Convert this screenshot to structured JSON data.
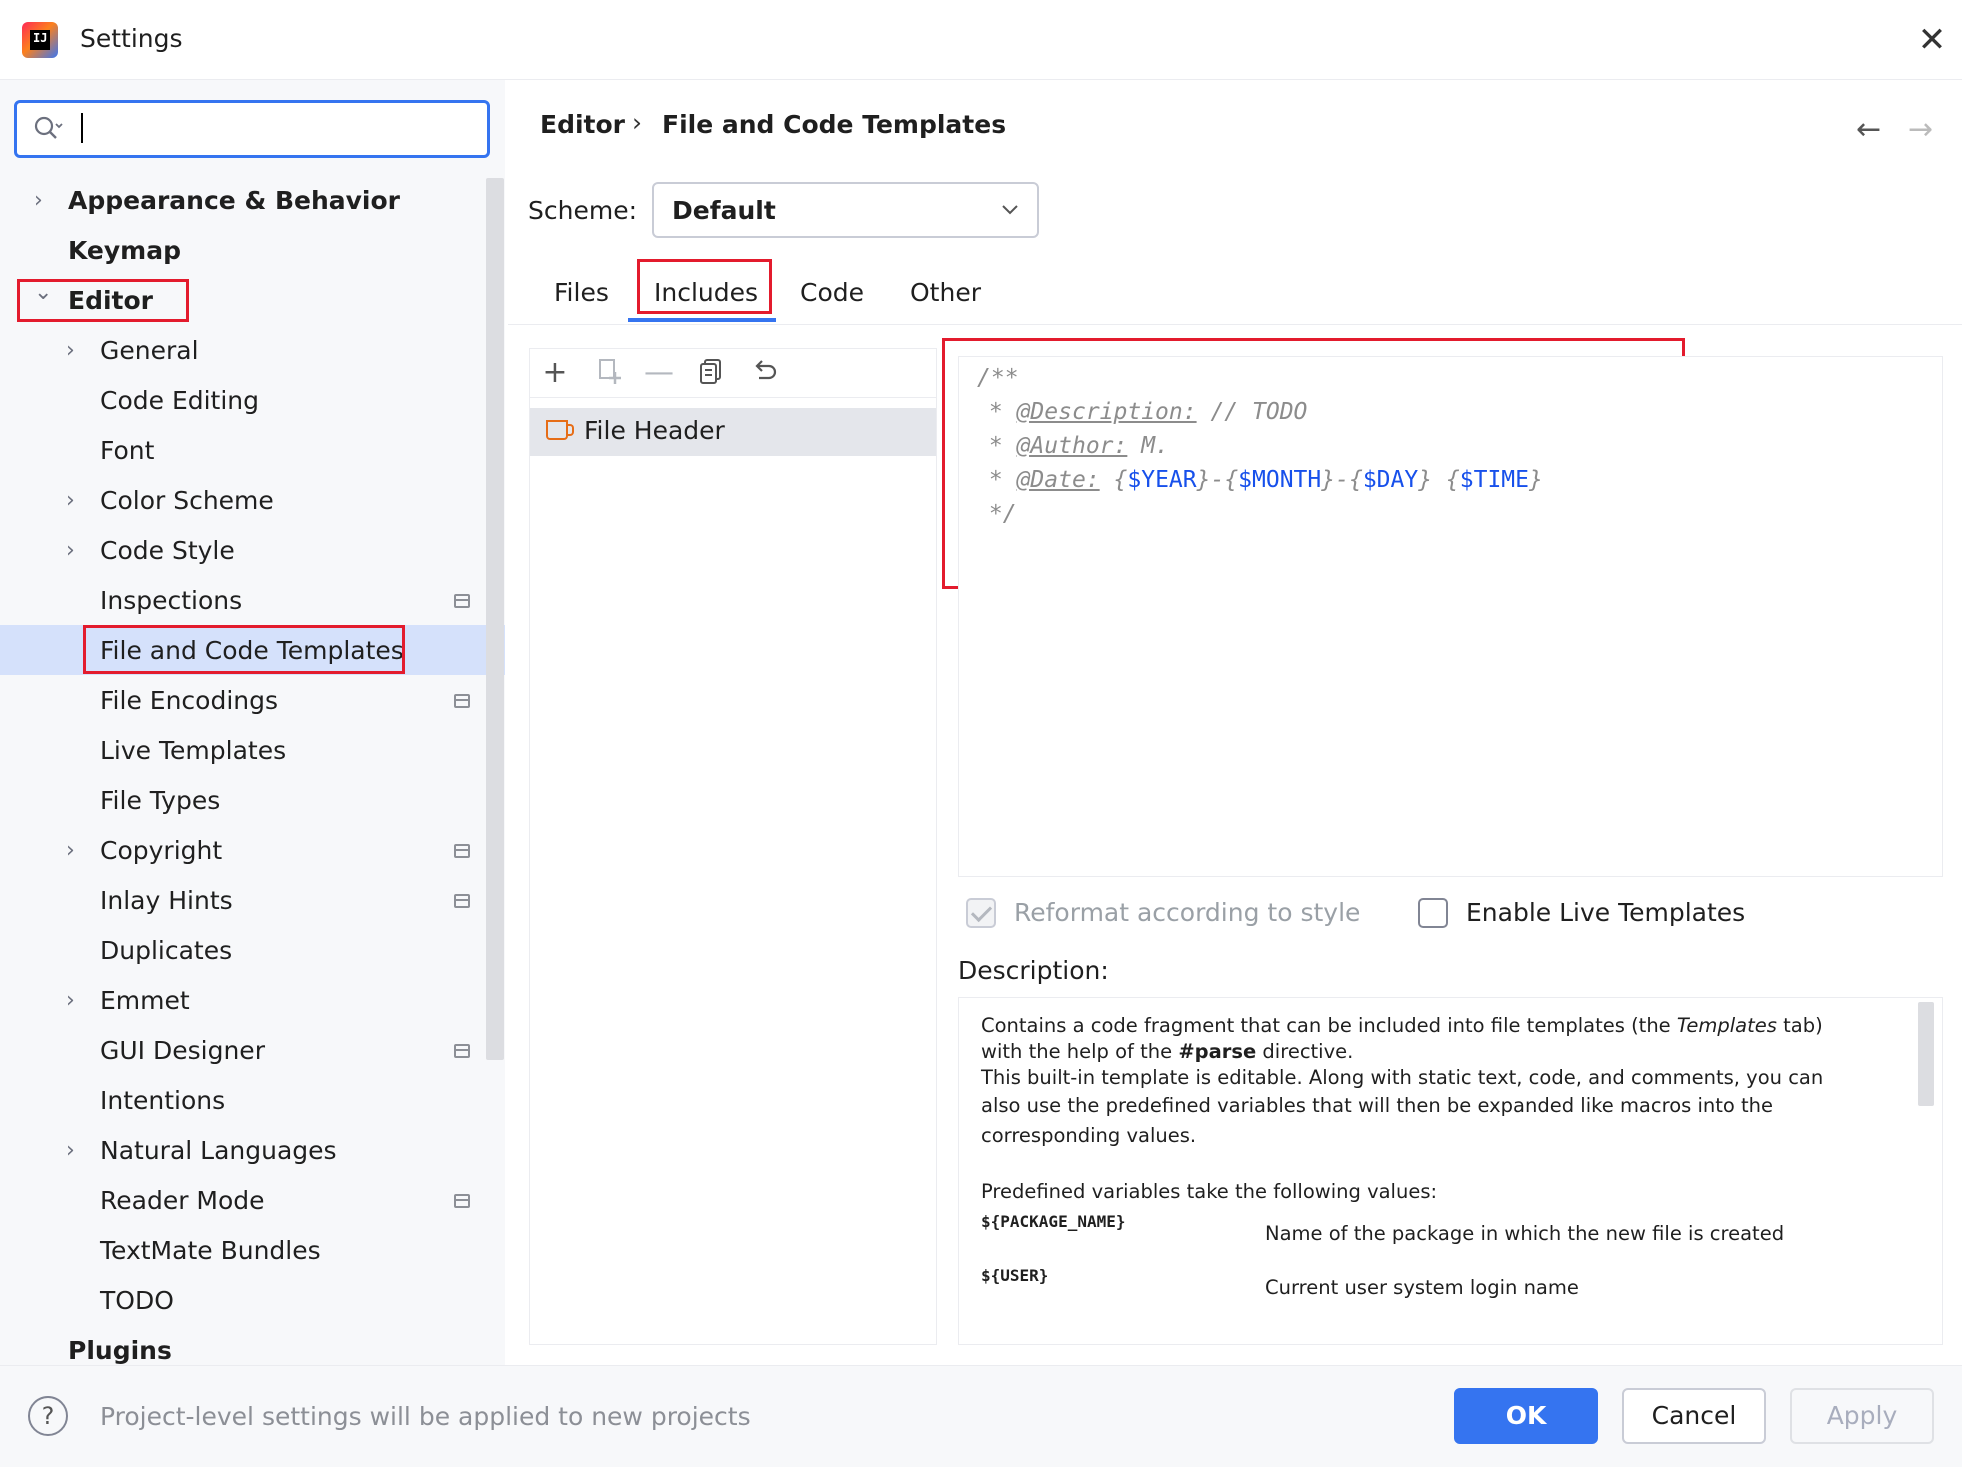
{
  "window": {
    "title": "Settings"
  },
  "sidebar": {
    "items": [
      {
        "label": "Appearance & Behavior",
        "level": 0,
        "bold": true,
        "expander": "collapsed"
      },
      {
        "label": "Keymap",
        "level": 0,
        "bold": true,
        "expander": "none"
      },
      {
        "label": "Editor",
        "level": 0,
        "bold": true,
        "expander": "expanded"
      },
      {
        "label": "General",
        "level": 1,
        "bold": false,
        "expander": "collapsed"
      },
      {
        "label": "Code Editing",
        "level": 1,
        "bold": false,
        "expander": "none"
      },
      {
        "label": "Font",
        "level": 1,
        "bold": false,
        "expander": "none"
      },
      {
        "label": "Color Scheme",
        "level": 1,
        "bold": false,
        "expander": "collapsed"
      },
      {
        "label": "Code Style",
        "level": 1,
        "bold": false,
        "expander": "collapsed"
      },
      {
        "label": "Inspections",
        "level": 1,
        "bold": false,
        "expander": "none",
        "project_icon": true
      },
      {
        "label": "File and Code Templates",
        "level": 1,
        "bold": false,
        "expander": "none",
        "selected": true
      },
      {
        "label": "File Encodings",
        "level": 1,
        "bold": false,
        "expander": "none",
        "project_icon": true
      },
      {
        "label": "Live Templates",
        "level": 1,
        "bold": false,
        "expander": "none"
      },
      {
        "label": "File Types",
        "level": 1,
        "bold": false,
        "expander": "none"
      },
      {
        "label": "Copyright",
        "level": 1,
        "bold": false,
        "expander": "collapsed",
        "project_icon": true
      },
      {
        "label": "Inlay Hints",
        "level": 1,
        "bold": false,
        "expander": "none",
        "project_icon": true
      },
      {
        "label": "Duplicates",
        "level": 1,
        "bold": false,
        "expander": "none"
      },
      {
        "label": "Emmet",
        "level": 1,
        "bold": false,
        "expander": "collapsed"
      },
      {
        "label": "GUI Designer",
        "level": 1,
        "bold": false,
        "expander": "none",
        "project_icon": true
      },
      {
        "label": "Intentions",
        "level": 1,
        "bold": false,
        "expander": "none"
      },
      {
        "label": "Natural Languages",
        "level": 1,
        "bold": false,
        "expander": "collapsed"
      },
      {
        "label": "Reader Mode",
        "level": 1,
        "bold": false,
        "expander": "none",
        "project_icon": true
      },
      {
        "label": "TextMate Bundles",
        "level": 1,
        "bold": false,
        "expander": "none"
      },
      {
        "label": "TODO",
        "level": 1,
        "bold": false,
        "expander": "none"
      },
      {
        "label": "Plugins",
        "level": 0,
        "bold": true,
        "expander": "none"
      }
    ]
  },
  "breadcrumb": {
    "parent": "Editor",
    "separator": "›",
    "current": "File and Code Templates"
  },
  "scheme": {
    "label": "Scheme:",
    "value": "Default"
  },
  "tabs": [
    {
      "label": "Files",
      "active": false
    },
    {
      "label": "Includes",
      "active": true
    },
    {
      "label": "Code",
      "active": false
    },
    {
      "label": "Other",
      "active": false
    }
  ],
  "toolbar": {
    "icons": [
      "add-icon",
      "add-child-icon",
      "remove-icon",
      "copy-icon",
      "reset-icon"
    ]
  },
  "template_list": {
    "items": [
      "File Header"
    ]
  },
  "code": {
    "open": "/**",
    "star": "*",
    "desc_tag": "@Description:",
    "desc_rest": "// TODO",
    "author_tag": "@Author:",
    "author_rest": "M.",
    "date_tag": "@Date:",
    "year": "$YEAR",
    "month": "$MONTH",
    "day": "$DAY",
    "time": "$TIME",
    "close": "*/"
  },
  "options": {
    "reformat_label": "Reformat according to style",
    "reformat_checked": true,
    "reformat_enabled": false,
    "live_templates_label": "Enable Live Templates",
    "live_templates_checked": false
  },
  "description": {
    "label": "Description:",
    "p1a": "Contains a code fragment that can be included into file templates (the ",
    "p1_em": "Templates",
    "p1b": " tab)",
    "p1c": "with the help of the ",
    "p1_strong": "#parse",
    "p1d": " directive.",
    "p2": "This built-in template is editable. Along with static text, code, and comments, you can",
    "p3": "also use the predefined variables that will then be expanded like macros into the",
    "p4": "corresponding values.",
    "p5": "Predefined variables take the following values:",
    "vars": [
      {
        "name": "${PACKAGE_NAME}",
        "desc": "Name of the package in which the new file is created"
      },
      {
        "name": "${USER}",
        "desc": "Current user system login name"
      }
    ]
  },
  "footer": {
    "note": "Project-level settings will be applied to new projects",
    "help": "?",
    "ok": "OK",
    "cancel": "Cancel",
    "apply": "Apply"
  },
  "colors": {
    "accent": "#3574f0",
    "annotation": "#e31b2d",
    "selection": "#d5e1fb",
    "variable": "#1750eb"
  }
}
